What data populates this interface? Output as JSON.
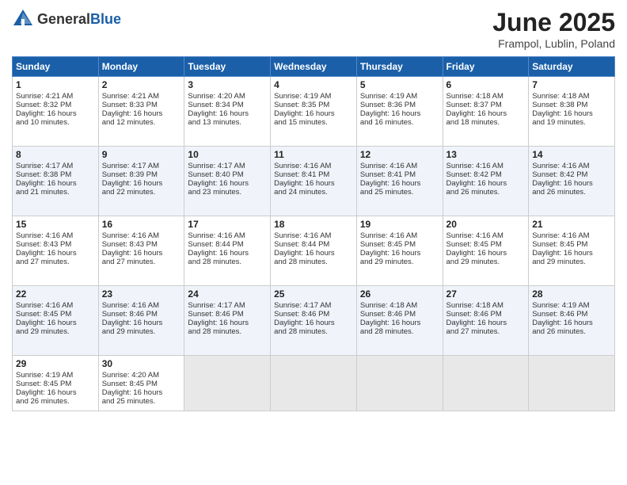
{
  "header": {
    "logo_general": "General",
    "logo_blue": "Blue",
    "title": "June 2025",
    "location": "Frampol, Lublin, Poland"
  },
  "weekdays": [
    "Sunday",
    "Monday",
    "Tuesday",
    "Wednesday",
    "Thursday",
    "Friday",
    "Saturday"
  ],
  "weeks": [
    [
      {
        "day": "1",
        "lines": [
          "Sunrise: 4:21 AM",
          "Sunset: 8:32 PM",
          "Daylight: 16 hours",
          "and 10 minutes."
        ]
      },
      {
        "day": "2",
        "lines": [
          "Sunrise: 4:21 AM",
          "Sunset: 8:33 PM",
          "Daylight: 16 hours",
          "and 12 minutes."
        ]
      },
      {
        "day": "3",
        "lines": [
          "Sunrise: 4:20 AM",
          "Sunset: 8:34 PM",
          "Daylight: 16 hours",
          "and 13 minutes."
        ]
      },
      {
        "day": "4",
        "lines": [
          "Sunrise: 4:19 AM",
          "Sunset: 8:35 PM",
          "Daylight: 16 hours",
          "and 15 minutes."
        ]
      },
      {
        "day": "5",
        "lines": [
          "Sunrise: 4:19 AM",
          "Sunset: 8:36 PM",
          "Daylight: 16 hours",
          "and 16 minutes."
        ]
      },
      {
        "day": "6",
        "lines": [
          "Sunrise: 4:18 AM",
          "Sunset: 8:37 PM",
          "Daylight: 16 hours",
          "and 18 minutes."
        ]
      },
      {
        "day": "7",
        "lines": [
          "Sunrise: 4:18 AM",
          "Sunset: 8:38 PM",
          "Daylight: 16 hours",
          "and 19 minutes."
        ]
      }
    ],
    [
      {
        "day": "8",
        "lines": [
          "Sunrise: 4:17 AM",
          "Sunset: 8:38 PM",
          "Daylight: 16 hours",
          "and 21 minutes."
        ]
      },
      {
        "day": "9",
        "lines": [
          "Sunrise: 4:17 AM",
          "Sunset: 8:39 PM",
          "Daylight: 16 hours",
          "and 22 minutes."
        ]
      },
      {
        "day": "10",
        "lines": [
          "Sunrise: 4:17 AM",
          "Sunset: 8:40 PM",
          "Daylight: 16 hours",
          "and 23 minutes."
        ]
      },
      {
        "day": "11",
        "lines": [
          "Sunrise: 4:16 AM",
          "Sunset: 8:41 PM",
          "Daylight: 16 hours",
          "and 24 minutes."
        ]
      },
      {
        "day": "12",
        "lines": [
          "Sunrise: 4:16 AM",
          "Sunset: 8:41 PM",
          "Daylight: 16 hours",
          "and 25 minutes."
        ]
      },
      {
        "day": "13",
        "lines": [
          "Sunrise: 4:16 AM",
          "Sunset: 8:42 PM",
          "Daylight: 16 hours",
          "and 26 minutes."
        ]
      },
      {
        "day": "14",
        "lines": [
          "Sunrise: 4:16 AM",
          "Sunset: 8:42 PM",
          "Daylight: 16 hours",
          "and 26 minutes."
        ]
      }
    ],
    [
      {
        "day": "15",
        "lines": [
          "Sunrise: 4:16 AM",
          "Sunset: 8:43 PM",
          "Daylight: 16 hours",
          "and 27 minutes."
        ]
      },
      {
        "day": "16",
        "lines": [
          "Sunrise: 4:16 AM",
          "Sunset: 8:43 PM",
          "Daylight: 16 hours",
          "and 27 minutes."
        ]
      },
      {
        "day": "17",
        "lines": [
          "Sunrise: 4:16 AM",
          "Sunset: 8:44 PM",
          "Daylight: 16 hours",
          "and 28 minutes."
        ]
      },
      {
        "day": "18",
        "lines": [
          "Sunrise: 4:16 AM",
          "Sunset: 8:44 PM",
          "Daylight: 16 hours",
          "and 28 minutes."
        ]
      },
      {
        "day": "19",
        "lines": [
          "Sunrise: 4:16 AM",
          "Sunset: 8:45 PM",
          "Daylight: 16 hours",
          "and 29 minutes."
        ]
      },
      {
        "day": "20",
        "lines": [
          "Sunrise: 4:16 AM",
          "Sunset: 8:45 PM",
          "Daylight: 16 hours",
          "and 29 minutes."
        ]
      },
      {
        "day": "21",
        "lines": [
          "Sunrise: 4:16 AM",
          "Sunset: 8:45 PM",
          "Daylight: 16 hours",
          "and 29 minutes."
        ]
      }
    ],
    [
      {
        "day": "22",
        "lines": [
          "Sunrise: 4:16 AM",
          "Sunset: 8:45 PM",
          "Daylight: 16 hours",
          "and 29 minutes."
        ]
      },
      {
        "day": "23",
        "lines": [
          "Sunrise: 4:16 AM",
          "Sunset: 8:46 PM",
          "Daylight: 16 hours",
          "and 29 minutes."
        ]
      },
      {
        "day": "24",
        "lines": [
          "Sunrise: 4:17 AM",
          "Sunset: 8:46 PM",
          "Daylight: 16 hours",
          "and 28 minutes."
        ]
      },
      {
        "day": "25",
        "lines": [
          "Sunrise: 4:17 AM",
          "Sunset: 8:46 PM",
          "Daylight: 16 hours",
          "and 28 minutes."
        ]
      },
      {
        "day": "26",
        "lines": [
          "Sunrise: 4:18 AM",
          "Sunset: 8:46 PM",
          "Daylight: 16 hours",
          "and 28 minutes."
        ]
      },
      {
        "day": "27",
        "lines": [
          "Sunrise: 4:18 AM",
          "Sunset: 8:46 PM",
          "Daylight: 16 hours",
          "and 27 minutes."
        ]
      },
      {
        "day": "28",
        "lines": [
          "Sunrise: 4:19 AM",
          "Sunset: 8:46 PM",
          "Daylight: 16 hours",
          "and 26 minutes."
        ]
      }
    ],
    [
      {
        "day": "29",
        "lines": [
          "Sunrise: 4:19 AM",
          "Sunset: 8:45 PM",
          "Daylight: 16 hours",
          "and 26 minutes."
        ]
      },
      {
        "day": "30",
        "lines": [
          "Sunrise: 4:20 AM",
          "Sunset: 8:45 PM",
          "Daylight: 16 hours",
          "and 25 minutes."
        ]
      },
      null,
      null,
      null,
      null,
      null
    ]
  ]
}
